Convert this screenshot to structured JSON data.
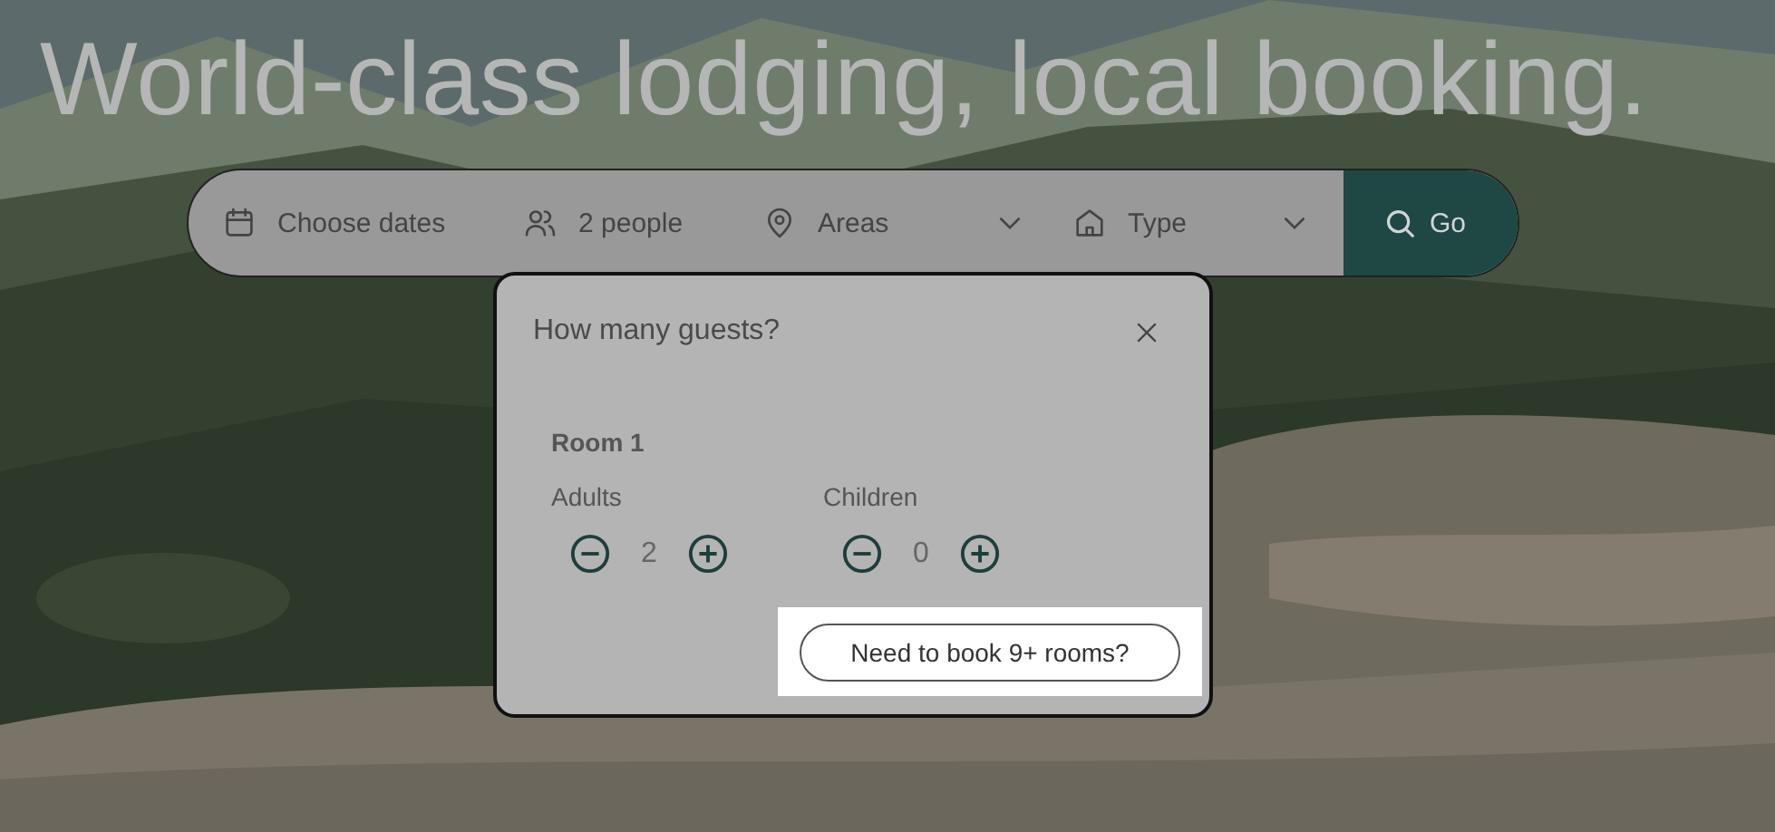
{
  "headline": "World-class lodging, local booking.",
  "search_bar": {
    "fields": [
      {
        "kind": "dates",
        "label": "Choose dates",
        "dropdown": false
      },
      {
        "kind": "people",
        "label": "2 people",
        "dropdown": false
      },
      {
        "kind": "area",
        "label": "Areas",
        "dropdown": true
      },
      {
        "kind": "type",
        "label": "Type",
        "dropdown": true
      }
    ],
    "go_button": "Go"
  },
  "guests_popup": {
    "title": "How many guests?",
    "room": "Room 1",
    "counters": [
      {
        "label": "Adults",
        "value": "2"
      },
      {
        "label": "Children",
        "value": "0"
      }
    ],
    "large_group_button": "Need to book 9+ rooms?"
  }
}
